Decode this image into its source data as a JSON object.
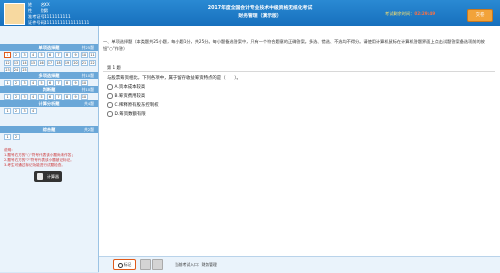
{
  "header": {
    "candidate": {
      "name_label": "姓　　名：",
      "name_value": "XX",
      "gender_label": "性　　别：",
      "gender_value": "男",
      "exam_no_label": "准考证号：",
      "exam_no_value": "1111111111",
      "id_label": "证件号码：",
      "id_value": "11111111111111111"
    },
    "title_line1": "2017年度全国会计专业技术中级资格无纸化考试",
    "title_line2": "财务管理（演示版）",
    "timer_label": "考试剩余时间：",
    "timer_value": "02:29:49",
    "submit_label": "交卷"
  },
  "left_panel": {
    "sections": [
      {
        "title": "单项选择题",
        "count": "共25题",
        "cells": [
          "1",
          "2",
          "3",
          "4",
          "5",
          "6",
          "7",
          "8",
          "9",
          "10",
          "11",
          "12",
          "13",
          "14",
          "15",
          "16",
          "17",
          "18",
          "19",
          "20",
          "21",
          "22",
          "23",
          "24",
          "25"
        ],
        "current": "1"
      },
      {
        "title": "多项选择题",
        "count": "共10题",
        "cells": [
          "1",
          "2",
          "3",
          "4",
          "5",
          "6",
          "7",
          "8",
          "9",
          "10"
        ]
      },
      {
        "title": "判断题",
        "count": "共10题",
        "cells": [
          "1",
          "2",
          "3",
          "4",
          "5",
          "6",
          "7",
          "8",
          "9",
          "10"
        ]
      },
      {
        "title": "计算分析题",
        "count": "共4题",
        "cells": [
          "1",
          "2",
          "3",
          "4"
        ]
      },
      {
        "title": "综合题",
        "count": "共2题",
        "cells": [
          "1",
          "2"
        ]
      }
    ],
    "legend_title": "说明：",
    "legend_lines": [
      "1.题号右方的\"○\"符号代表该小题尚未作答；",
      "2.题号右方的\"?\"符号代表该小题被记标记。",
      "3.考生可通过标记功能进行试题检查。"
    ],
    "calculator_label": "计算器"
  },
  "main": {
    "instructions": "一、单项选择题（本类题共25小题，每小题1分，共25分。每小题备选答案中，只有一个符合题意的正确答案。多选、错选、不选均不得分。请使用计算机鼠标在计算机答题界面上点击试题答案备选项前的按钮\"○\"作答）",
    "question_number": "第 1 题",
    "question_text": "与股票筹资相比，下列各项中，属于留存收益筹资特点的是（　　）。",
    "options": [
      {
        "letter": "A",
        "text": "资本成本较高"
      },
      {
        "letter": "B",
        "text": "筹资费用较高"
      },
      {
        "letter": "C",
        "text": "稀释原有股东控制权"
      },
      {
        "letter": "D",
        "text": "筹资数额有限"
      }
    ],
    "mark_label": "标记",
    "status_text": "当前考试入口：财务管理"
  },
  "colors": {
    "header": "#1e7cc6",
    "section": "#6aa7d8",
    "accent": "#e05a1a",
    "submit": "#f2a33a"
  }
}
